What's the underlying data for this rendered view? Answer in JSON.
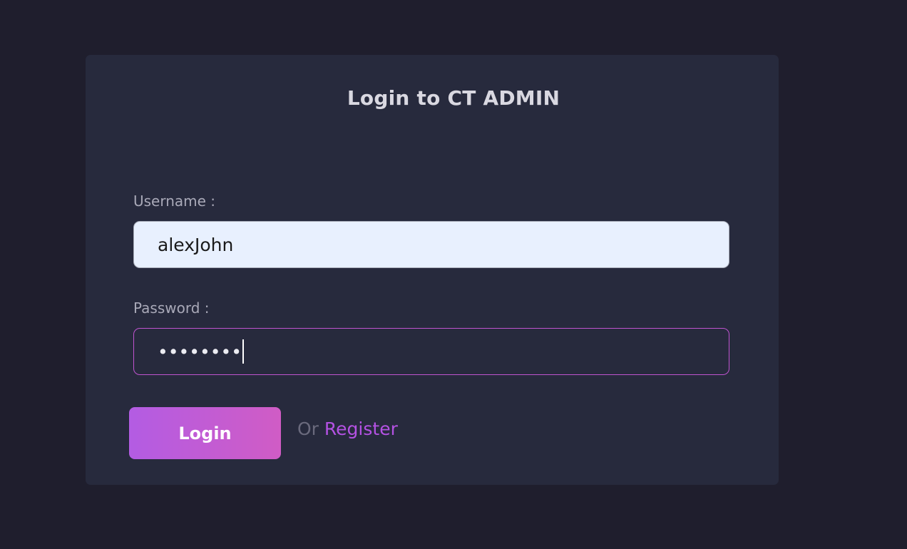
{
  "page": {
    "title": "Login to CT ADMIN"
  },
  "form": {
    "username_label": "Username :",
    "username_value": "alexJohn",
    "password_label": "Password :",
    "password_masked": "••••••••",
    "login_label": "Login",
    "or_text": "Or",
    "register_label": "Register"
  },
  "colors": {
    "background": "#1f1e2d",
    "card": "#272a3d",
    "accent": "#c054d0",
    "button_gradient_start": "#b35ce3",
    "button_gradient_end": "#d05cc5",
    "register_link": "#b452e3"
  }
}
